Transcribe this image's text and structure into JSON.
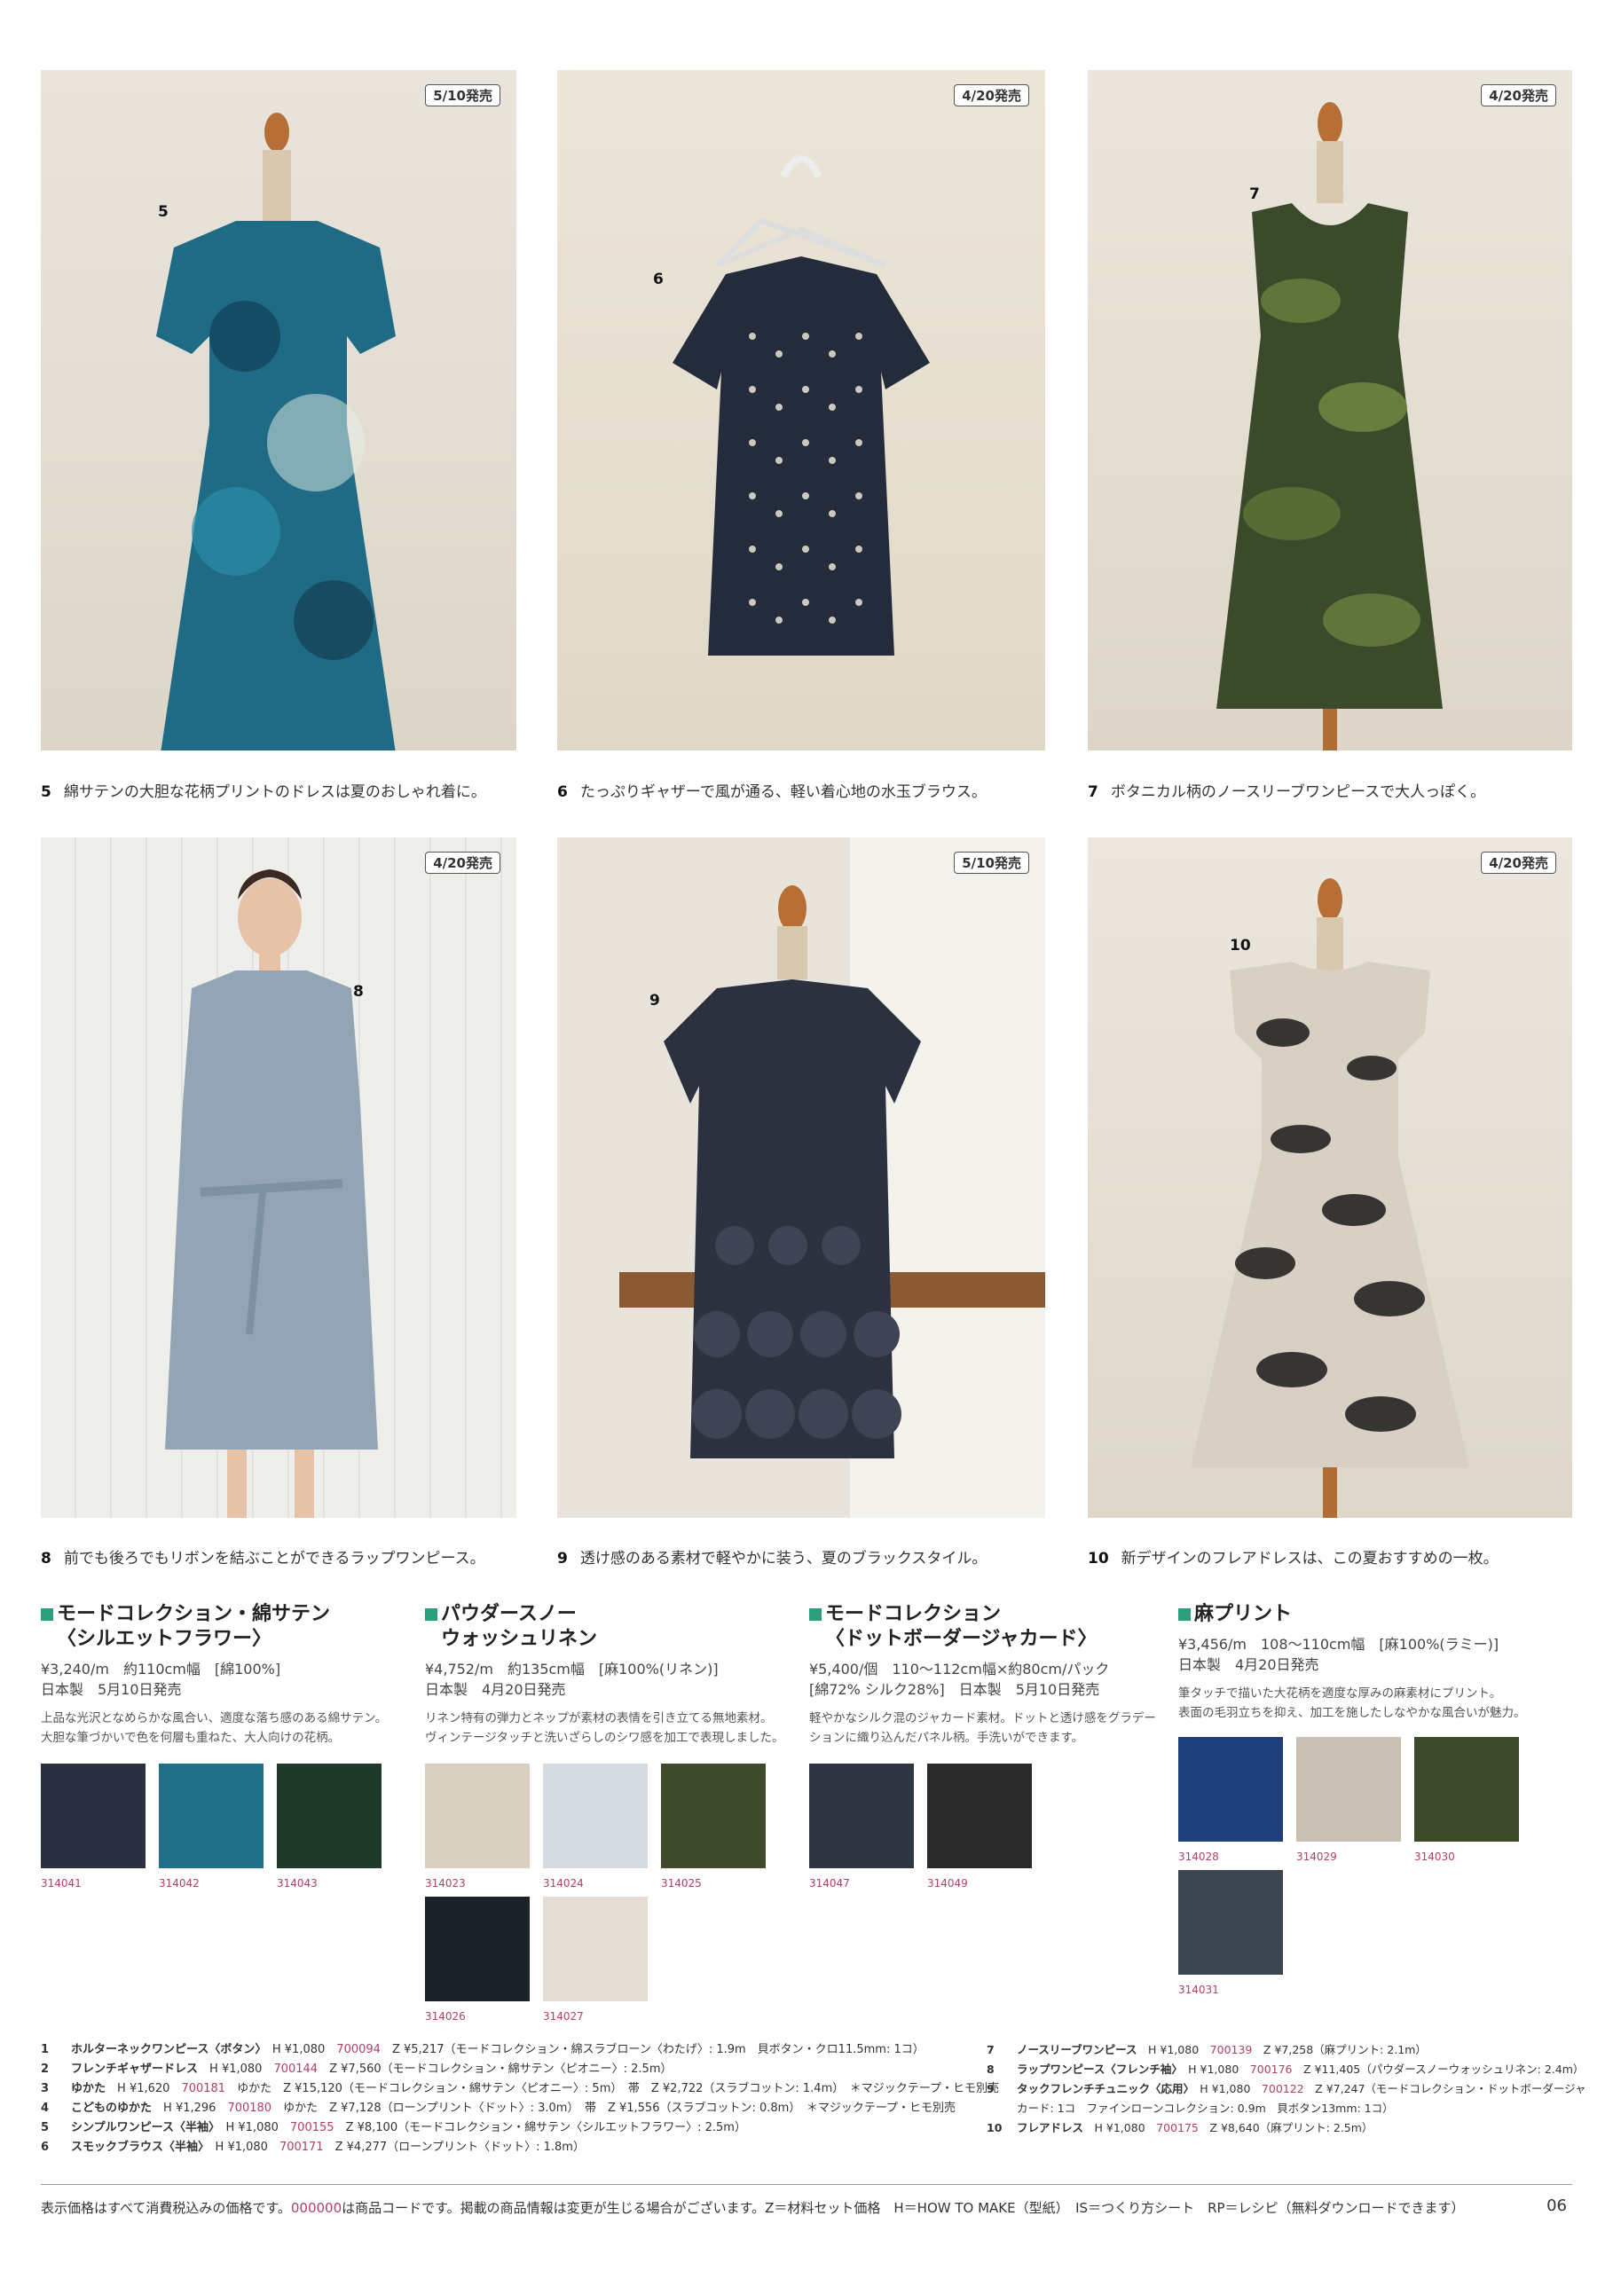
{
  "photos": [
    {
      "badge": "5/10発売",
      "num": "5",
      "caption_num": "5",
      "caption": "綿サテンの大胆な花柄プリントのドレスは夏のおしゃれ着に。"
    },
    {
      "badge": "4/20発売",
      "num": "6",
      "caption_num": "6",
      "caption": "たっぷりギャザーで風が通る、軽い着心地の水玉ブラウス。"
    },
    {
      "badge": "4/20発売",
      "num": "7",
      "caption_num": "7",
      "caption": "ボタニカル柄のノースリーブワンピースで大人っぽく。"
    },
    {
      "badge": "4/20発売",
      "num": "8",
      "caption_num": "8",
      "caption": "前でも後ろでもリボンを結ぶことができるラップワンピース。"
    },
    {
      "badge": "5/10発売",
      "num": "9",
      "caption_num": "9",
      "caption": "透け感のある素材で軽やかに装う、夏のブラックスタイル。"
    },
    {
      "badge": "4/20発売",
      "num": "10",
      "caption_num": "10",
      "caption": "新デザインのフレアドレスは、この夏おすすめの一枚。"
    }
  ],
  "sections": [
    {
      "title1": "モードコレクション・綿サテン",
      "title2": "〈シルエットフラワー〉",
      "info1": "¥3,240/m　約110cm幅　[綿100%]",
      "info2": "日本製　5月10日発売",
      "desc1": "上品な光沢となめらかな風合い、適度な落ち感のある綿サテン。",
      "desc2": "大胆な筆づかいで色を何層も重ねた、大人向けの花柄。",
      "swatches": [
        {
          "code": "314041",
          "color": "#2a3040"
        },
        {
          "code": "314042",
          "color": "#1f6f86"
        },
        {
          "code": "314043",
          "color": "#1f3a2a"
        }
      ]
    },
    {
      "title1": "パウダースノー",
      "title2": "ウォッシュリネン",
      "info1": "¥4,752/m　約135cm幅　[麻100%(リネン)]",
      "info2": "日本製　4月20日発売",
      "desc1": "リネン特有の弾力とネップが素材の表情を引き立てる無地素材。",
      "desc2": "ヴィンテージタッチと洗いざらしのシワ感を加工で表現しました。",
      "swatches": [
        {
          "code": "314023",
          "color": "#d9d0c2"
        },
        {
          "code": "314024",
          "color": "#d6dbe2"
        },
        {
          "code": "314025",
          "color": "#3f4a2c"
        },
        {
          "code": "314026",
          "color": "#1b2329"
        },
        {
          "code": "314027",
          "color": "#e3ddd4"
        }
      ]
    },
    {
      "title1": "モードコレクション",
      "title2": "〈ドットボーダージャカード〉",
      "info1": "¥5,400/個　110〜112cm幅×約80cm/パック",
      "info2": "[綿72% シルク28%]　日本製　5月10日発売",
      "desc1": "軽やかなシルク混のジャカード素材。ドットと透け感をグラデー",
      "desc2": "ションに織り込んだパネル柄。手洗いができます。",
      "swatches": [
        {
          "code": "314047",
          "color": "#2e3440"
        },
        {
          "code": "314049",
          "color": "#2a2a2a"
        }
      ]
    },
    {
      "title1": "麻プリント",
      "title2": "",
      "info1": "¥3,456/m　108〜110cm幅　[麻100%(ラミー)]",
      "info2": "日本製　4月20日発売",
      "desc1": "筆タッチで描いた大花柄を適度な厚みの麻素材にプリント。",
      "desc2": "表面の毛羽立ちを抑え、加工を施したしなやかな風合いが魅力。",
      "swatches": [
        {
          "code": "314028",
          "color": "#1e3f7a"
        },
        {
          "code": "314029",
          "color": "#c9bfb3"
        },
        {
          "code": "314030",
          "color": "#3d4a2a"
        },
        {
          "code": "314031",
          "color": "#3c4550"
        }
      ]
    }
  ],
  "footer_left": [
    {
      "n": "1",
      "name": "ホルターネックワンピース〈ボタン〉",
      "h": "H ¥1,080",
      "code": "700094",
      "rest": "Z ¥5,217（モードコレクション・綿スラブローン〈わたげ〉: 1.9m　貝ボタン・クロ11.5mm: 1コ）"
    },
    {
      "n": "2",
      "name": "フレンチギャザードレス",
      "h": "H ¥1,080",
      "code": "700144",
      "rest": "Z ¥7,560（モードコレクション・綿サテン〈ピオニー〉: 2.5m）"
    },
    {
      "n": "3",
      "name": "ゆかた",
      "h": "H ¥1,620",
      "code": "700181",
      "rest": "ゆかた　Z ¥15,120（モードコレクション・綿サテン〈ピオニー〉: 5m）　帯　Z ¥2,722（スラブコットン: 1.4m）　＊マジックテープ・ヒモ別売"
    },
    {
      "n": "4",
      "name": "こどものゆかた",
      "h": "H ¥1,296",
      "code": "700180",
      "rest": "ゆかた　Z ¥7,128（ローンプリント〈ドット〉: 3.0m）　帯　Z ¥1,556（スラブコットン: 0.8m）　＊マジックテープ・ヒモ別売"
    },
    {
      "n": "5",
      "name": "シンプルワンピース〈半袖〉",
      "h": "H ¥1,080",
      "code": "700155",
      "rest": "Z ¥8,100（モードコレクション・綿サテン〈シルエットフラワー〉: 2.5m）"
    },
    {
      "n": "6",
      "name": "スモックブラウス〈半袖〉",
      "h": "H ¥1,080",
      "code": "700171",
      "rest": "Z ¥4,277（ローンプリント〈ドット〉: 1.8m）"
    }
  ],
  "footer_right": [
    {
      "n": "7",
      "name": "ノースリーブワンピース",
      "h": "H ¥1,080",
      "code": "700139",
      "rest": "Z ¥7,258（麻プリント: 2.1m）"
    },
    {
      "n": "8",
      "name": "ラップワンピース〈フレンチ袖〉",
      "h": "H ¥1,080",
      "code": "700176",
      "rest": "Z ¥11,405（パウダースノーウォッシュリネン: 2.4m）"
    },
    {
      "n": "9",
      "name": "タックフレンチチュニック〈応用〉",
      "h": "H ¥1,080",
      "code": "700122",
      "rest": "Z ¥7,247（モードコレクション・ドットボーダージャ"
    },
    {
      "n": "",
      "name": "",
      "h": "",
      "code": "",
      "rest": "カード: 1コ　ファインローンコレクション: 0.9m　貝ボタン13mm: 1コ）"
    },
    {
      "n": "10",
      "name": "フレアドレス",
      "h": "H ¥1,080",
      "code": "700175",
      "rest": "Z ¥8,640（麻プリント: 2.5m）"
    }
  ],
  "bottom_note_a": "表示価格はすべて消費税込みの価格です。",
  "bottom_note_code": "000000",
  "bottom_note_b": "は商品コードです。掲載の商品情報は変更が生じる場合がございます。Z＝材料セット価格　H＝HOW TO MAKE（型紙）　IS＝つくり方シート　RP＝レシピ（無料ダウンロードできます）",
  "page_number": "06"
}
